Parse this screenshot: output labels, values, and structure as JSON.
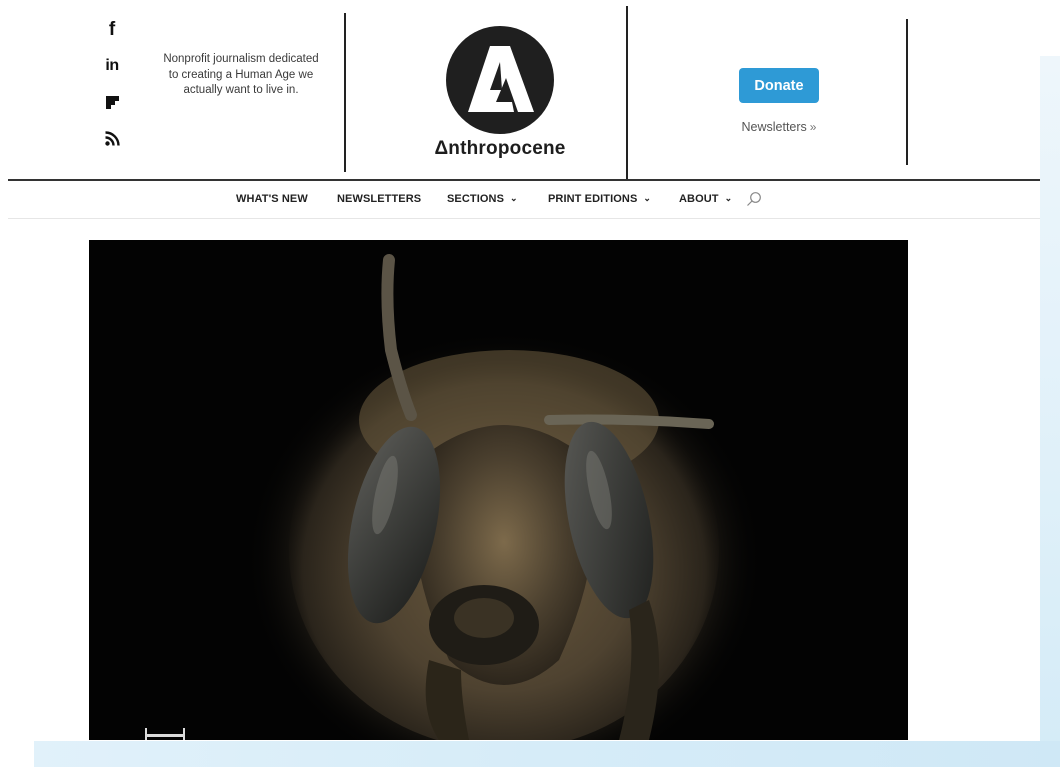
{
  "social": {
    "facebook_glyph": "f",
    "linkedin_glyph": "in",
    "icons": [
      "facebook-icon",
      "linkedin-icon",
      "flipboard-icon",
      "rss-icon"
    ]
  },
  "header": {
    "tagline": "Nonprofit journalism dedicated to creating a Human Age we actually want to live in.",
    "brand_name": "Δnthropocene",
    "donate_label": "Donate",
    "newsletters_label": "Newsletters",
    "newsletters_arrow": "»",
    "accent_color": "#2e9ad6"
  },
  "nav": {
    "items": [
      {
        "label": "WHAT'S NEW",
        "has_dropdown": false
      },
      {
        "label": "NEWSLETTERS",
        "has_dropdown": false
      },
      {
        "label": "SECTIONS",
        "has_dropdown": true
      },
      {
        "label": "PRINT EDITIONS",
        "has_dropdown": true
      },
      {
        "label": "ABOUT",
        "has_dropdown": true
      }
    ],
    "chevron": "⌄",
    "search_icon": "search-icon"
  },
  "hero": {
    "subject": "bee-head-macro-photo"
  }
}
